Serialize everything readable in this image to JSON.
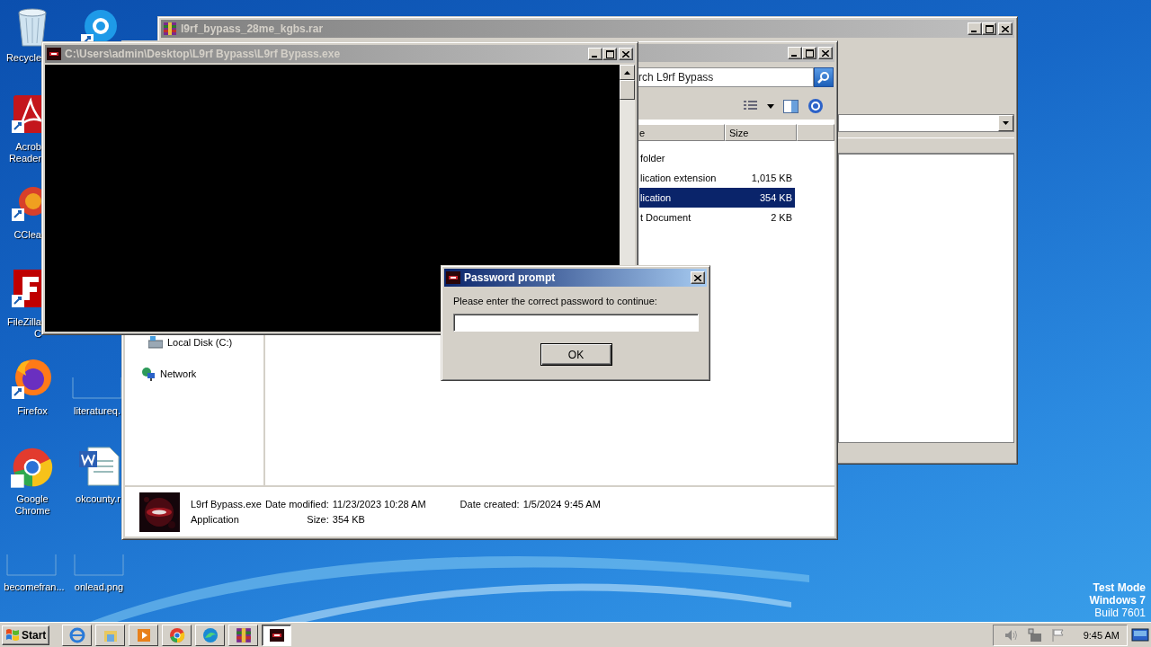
{
  "desktop": {
    "icons": [
      {
        "label": "Recycle"
      },
      {
        "label": "Acrob\nReader"
      },
      {
        "label": "CClea"
      },
      {
        "label": "FileZilla C"
      },
      {
        "label": "Firefox"
      },
      {
        "label": "Google Chrome"
      },
      {
        "label": "becomefran..."
      },
      {
        "label": "literatureq."
      },
      {
        "label": "okcounty.r"
      },
      {
        "label": "onlead.png"
      }
    ],
    "notice": [
      "Test Mode",
      "Windows 7",
      "Build 7601"
    ]
  },
  "archive_window": {
    "title": "l9rf_bypass_28me_kgbs.rar"
  },
  "explorer_window": {
    "search": {
      "placeholder": "rch L9rf Bypass"
    },
    "columns": [
      "e",
      "Size"
    ],
    "files": [
      {
        "column_1": "folder",
        "selected": false
      },
      {
        "column_1": "lication extension",
        "size": "1,015 KB",
        "selected": false
      },
      {
        "column_1": "lication",
        "size": "354 KB",
        "selected": true
      },
      {
        "column_1": "t Document",
        "size": "2 KB",
        "selected": false
      }
    ],
    "nav": [
      {
        "kind": "drive",
        "label": "Local Disk (C:)"
      },
      {
        "kind": "network",
        "label": "Network"
      }
    ],
    "details": {
      "name": "L9rf Bypass.exe",
      "type": "Application",
      "fields": [
        {
          "label": "Date modified:",
          "value": "11/23/2023 10:28 AM"
        },
        {
          "label": "Size:",
          "value": "354 KB"
        },
        {
          "label": "Date created:",
          "value": "1/5/2024 9:45 AM"
        }
      ]
    }
  },
  "console_window": {
    "title": "C:\\Users\\admin\\Desktop\\L9rf Bypass\\L9rf Bypass.exe"
  },
  "password_dialog": {
    "title": "Password prompt",
    "message": "Please enter the correct password to continue:",
    "ok_button": "OK"
  },
  "taskbar": {
    "start": "Start",
    "buttons": [
      {
        "selected": false
      },
      {
        "selected": false
      },
      {
        "selected": false
      },
      {
        "selected": false
      },
      {
        "selected": false
      },
      {
        "selected": false
      },
      {
        "selected": true
      }
    ],
    "clock": "9:45 AM"
  }
}
